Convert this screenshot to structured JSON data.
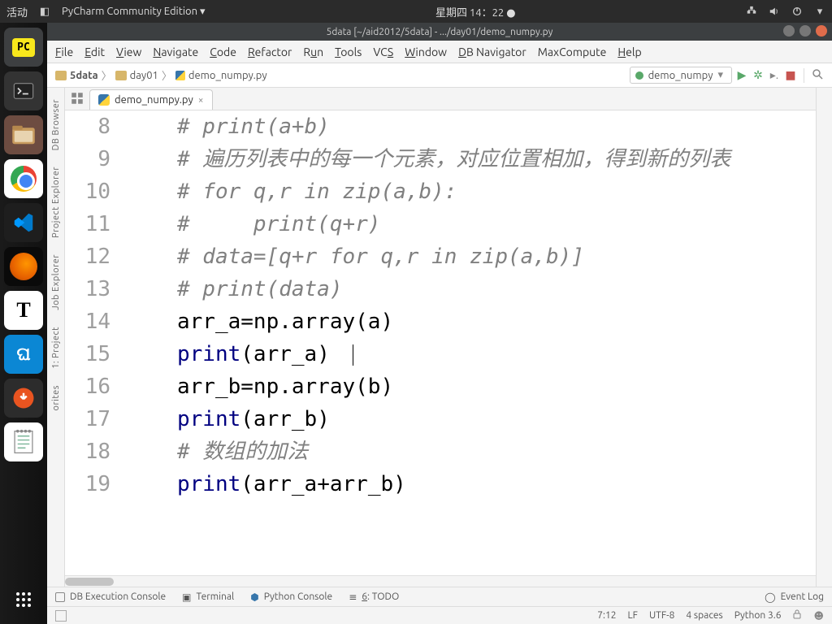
{
  "sysbar": {
    "activities": "活动",
    "app_indicator": "PyCharm Community Edition ▾",
    "datetime": "星期四 14：22 ●"
  },
  "titlebar": {
    "text": "5data [~/aid2012/5data] - .../day01/demo_numpy.py"
  },
  "menu": {
    "file": "File",
    "edit": "Edit",
    "view": "View",
    "navigate": "Navigate",
    "code": "Code",
    "refactor": "Refactor",
    "run": "Run",
    "tools": "Tools",
    "vcs": "VCS",
    "window": "Window",
    "dbnav": "DB Navigator",
    "maxcompute": "MaxCompute",
    "help": "Help"
  },
  "breadcrumbs": {
    "root": "5data",
    "folder": "day01",
    "file": "demo_numpy.py"
  },
  "run_config": {
    "selected": "demo_numpy"
  },
  "tab": {
    "filename": "demo_numpy.py"
  },
  "left_tools": {
    "db_browser": "DB Browser",
    "project_explorer": "Project Explorer",
    "job_explorer": "Job Explorer",
    "project": "1: Project",
    "favorites": "orites"
  },
  "code": {
    "l8": "# print(a+b)",
    "l9": "# 遍历列表中的每一个元素，对应位置相加，得到新的列表",
    "l10": "# for q,r in zip(a,b):",
    "l11": "#     print(q+r)",
    "l12": "# data=[q+r for q,r in zip(a,b)]",
    "l13": "# print(data)",
    "l14_a": "arr_a=np.array(a)",
    "l15_print": "print",
    "l15_rest": "(arr_a)",
    "l16_a": "arr_b=np.array(b)",
    "l17_print": "print",
    "l17_rest": "(arr_b)",
    "l18": "# 数组的加法",
    "l19_print": "print",
    "l19_rest": "(arr_a+arr_b)"
  },
  "line_numbers": [
    "8",
    "9",
    "10",
    "11",
    "12",
    "13",
    "14",
    "15",
    "16",
    "17",
    "18",
    "19"
  ],
  "bottombar": {
    "db_console": "DB Execution Console",
    "terminal": "Terminal",
    "py_console": "Python Console",
    "todo": "6: TODO",
    "event_log": "Event Log"
  },
  "statusbar": {
    "pos": "7:12",
    "lf": "LF",
    "enc": "UTF-8",
    "indent": "4 spaces",
    "python": "Python 3.6"
  }
}
